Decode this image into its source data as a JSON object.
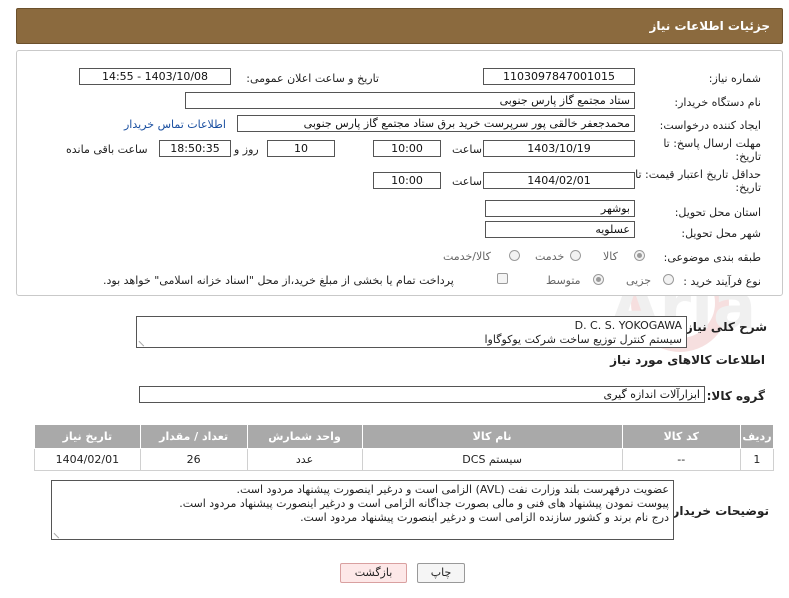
{
  "header": {
    "title": "جزئیات اطلاعات نیاز"
  },
  "form": {
    "need_number_label": "شماره نیاز:",
    "need_number": "1103097847001015",
    "announce_label": "تاریخ و ساعت اعلان عمومی:",
    "announce_value": "1403/10/08 - 14:55",
    "buyer_org_label": "نام دستگاه خریدار:",
    "buyer_org": "ستاد مجتمع گاز پارس جنوبی",
    "creator_label": "ایجاد کننده درخواست:",
    "creator": "محمدجعفر خالقی پور سرپرست خرید برق ستاد مجتمع گاز پارس جنوبی",
    "contact_link": "اطلاعات تماس خریدار",
    "deadline_label_1": "مهلت ارسال پاسخ: تا",
    "deadline_label_2": "تاریخ:",
    "deadline_date": "1403/10/19",
    "time_label": "ساعت",
    "deadline_time": "10:00",
    "days_value": "10",
    "days_label": "روز و",
    "remaining_time": "18:50:35",
    "remaining_label": "ساعت باقی مانده",
    "validity_label_1": "حداقل تاریخ اعتبار قیمت: تا",
    "validity_label_2": "تاریخ:",
    "validity_date": "1404/02/01",
    "validity_time_label": "ساعت",
    "validity_time": "10:00",
    "province_label": "استان محل تحویل:",
    "province": "بوشهر",
    "city_label": "شهر محل تحویل:",
    "city": "عسلویه",
    "category_label": "طبقه بندی موضوعی:",
    "category_options": [
      "کالا",
      "خدمت",
      "کالا/خدمت"
    ],
    "process_label": "نوع فرآیند خرید :",
    "process_options": [
      "جزیی",
      "متوسط"
    ],
    "treasury_note": "پرداخت تمام یا بخشی از مبلغ خرید،از محل \"اسناد خزانه اسلامی\" خواهد بود."
  },
  "summary": {
    "label": "شرح کلی نیاز:",
    "line1": "D. C. S. YOKOGAWA",
    "line2": "سیستم کنترل توزیع ساخت شرکت یوکوگاوا"
  },
  "goods": {
    "section_title": "اطلاعات کالاهای مورد نیاز",
    "group_label": "گروه کالا:",
    "group_value": "ابزارآلات اندازه گیری",
    "columns": [
      "ردیف",
      "کد کالا",
      "نام کالا",
      "واحد شمارش",
      "تعداد / مقدار",
      "تاریخ نیاز"
    ],
    "rows": [
      [
        "1",
        "--",
        "سیستم DCS",
        "عدد",
        "26",
        "1404/02/01"
      ]
    ]
  },
  "buyer_notes": {
    "label": "توضیحات خریدار:",
    "line1": "عضویت درفهرست بلند وزارت نفت (AVL) الزامی است و درغیر اینصورت پیشنهاد مردود است.",
    "line2": "پیوست نمودن پیشنهاد های فنی و مالی بصورت جداگانه الزامی است و درغیر اینصورت پیشنهاد مردود است.",
    "line3": "درج نام برند و کشور سازنده الزامی است و درغیر اینصورت پیشنهاد مردود است."
  },
  "buttons": {
    "print": "چاپ",
    "back": "بازگشت"
  },
  "watermark": {
    "text": "AriaTender.net"
  }
}
